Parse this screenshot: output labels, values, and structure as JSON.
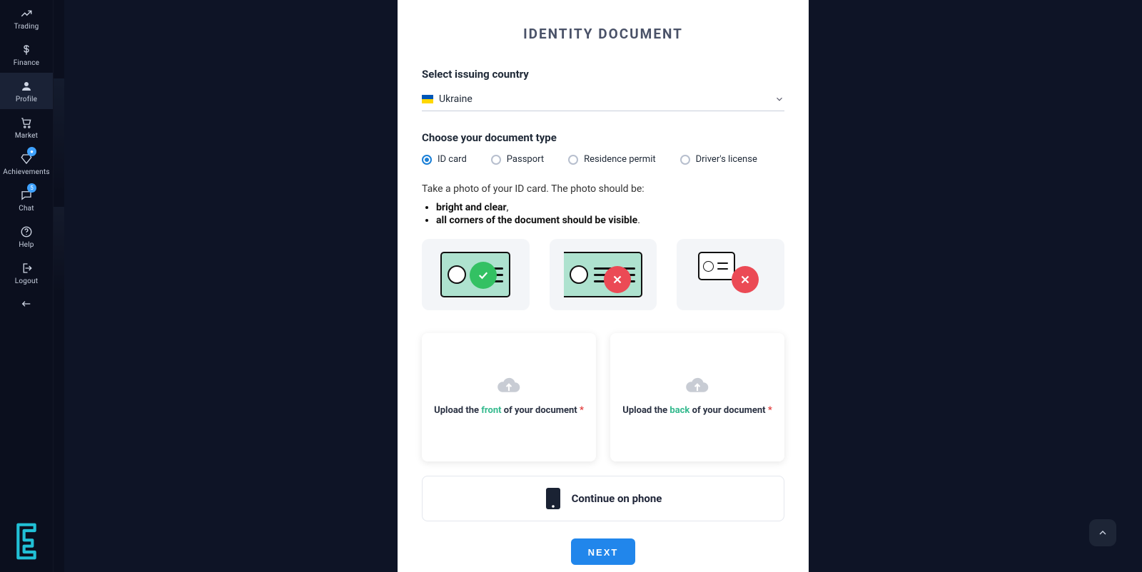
{
  "sidebar": {
    "items": [
      {
        "label": "Trading"
      },
      {
        "label": "Finance"
      },
      {
        "label": "Profile"
      },
      {
        "label": "Market"
      },
      {
        "label": "Achievements"
      },
      {
        "label": "Chat"
      },
      {
        "label": "Help"
      },
      {
        "label": "Logout"
      }
    ],
    "chat_badge": "5"
  },
  "page": {
    "title": "IDENTITY DOCUMENT",
    "country_section_label": "Select issuing country",
    "country_name": "Ukraine",
    "doc_type_label": "Choose your document type",
    "doc_types": [
      {
        "label": "ID card"
      },
      {
        "label": "Passport"
      },
      {
        "label": "Residence permit"
      },
      {
        "label": "Driver's license"
      }
    ],
    "instruction": "Take a photo of your ID card. The photo should be:",
    "bullets": [
      {
        "bold": "bright and clear",
        "rest": ","
      },
      {
        "bold": "all corners of the document should be visible",
        "rest": "."
      }
    ],
    "upload_front_prefix": "Upload the ",
    "upload_front_hl": "front",
    "upload_front_suffix": " of your document ",
    "upload_back_prefix": "Upload the ",
    "upload_back_hl": "back",
    "upload_back_suffix": " of your document ",
    "required_mark": "*",
    "continue_phone": "Continue on phone",
    "next": "NEXT"
  }
}
